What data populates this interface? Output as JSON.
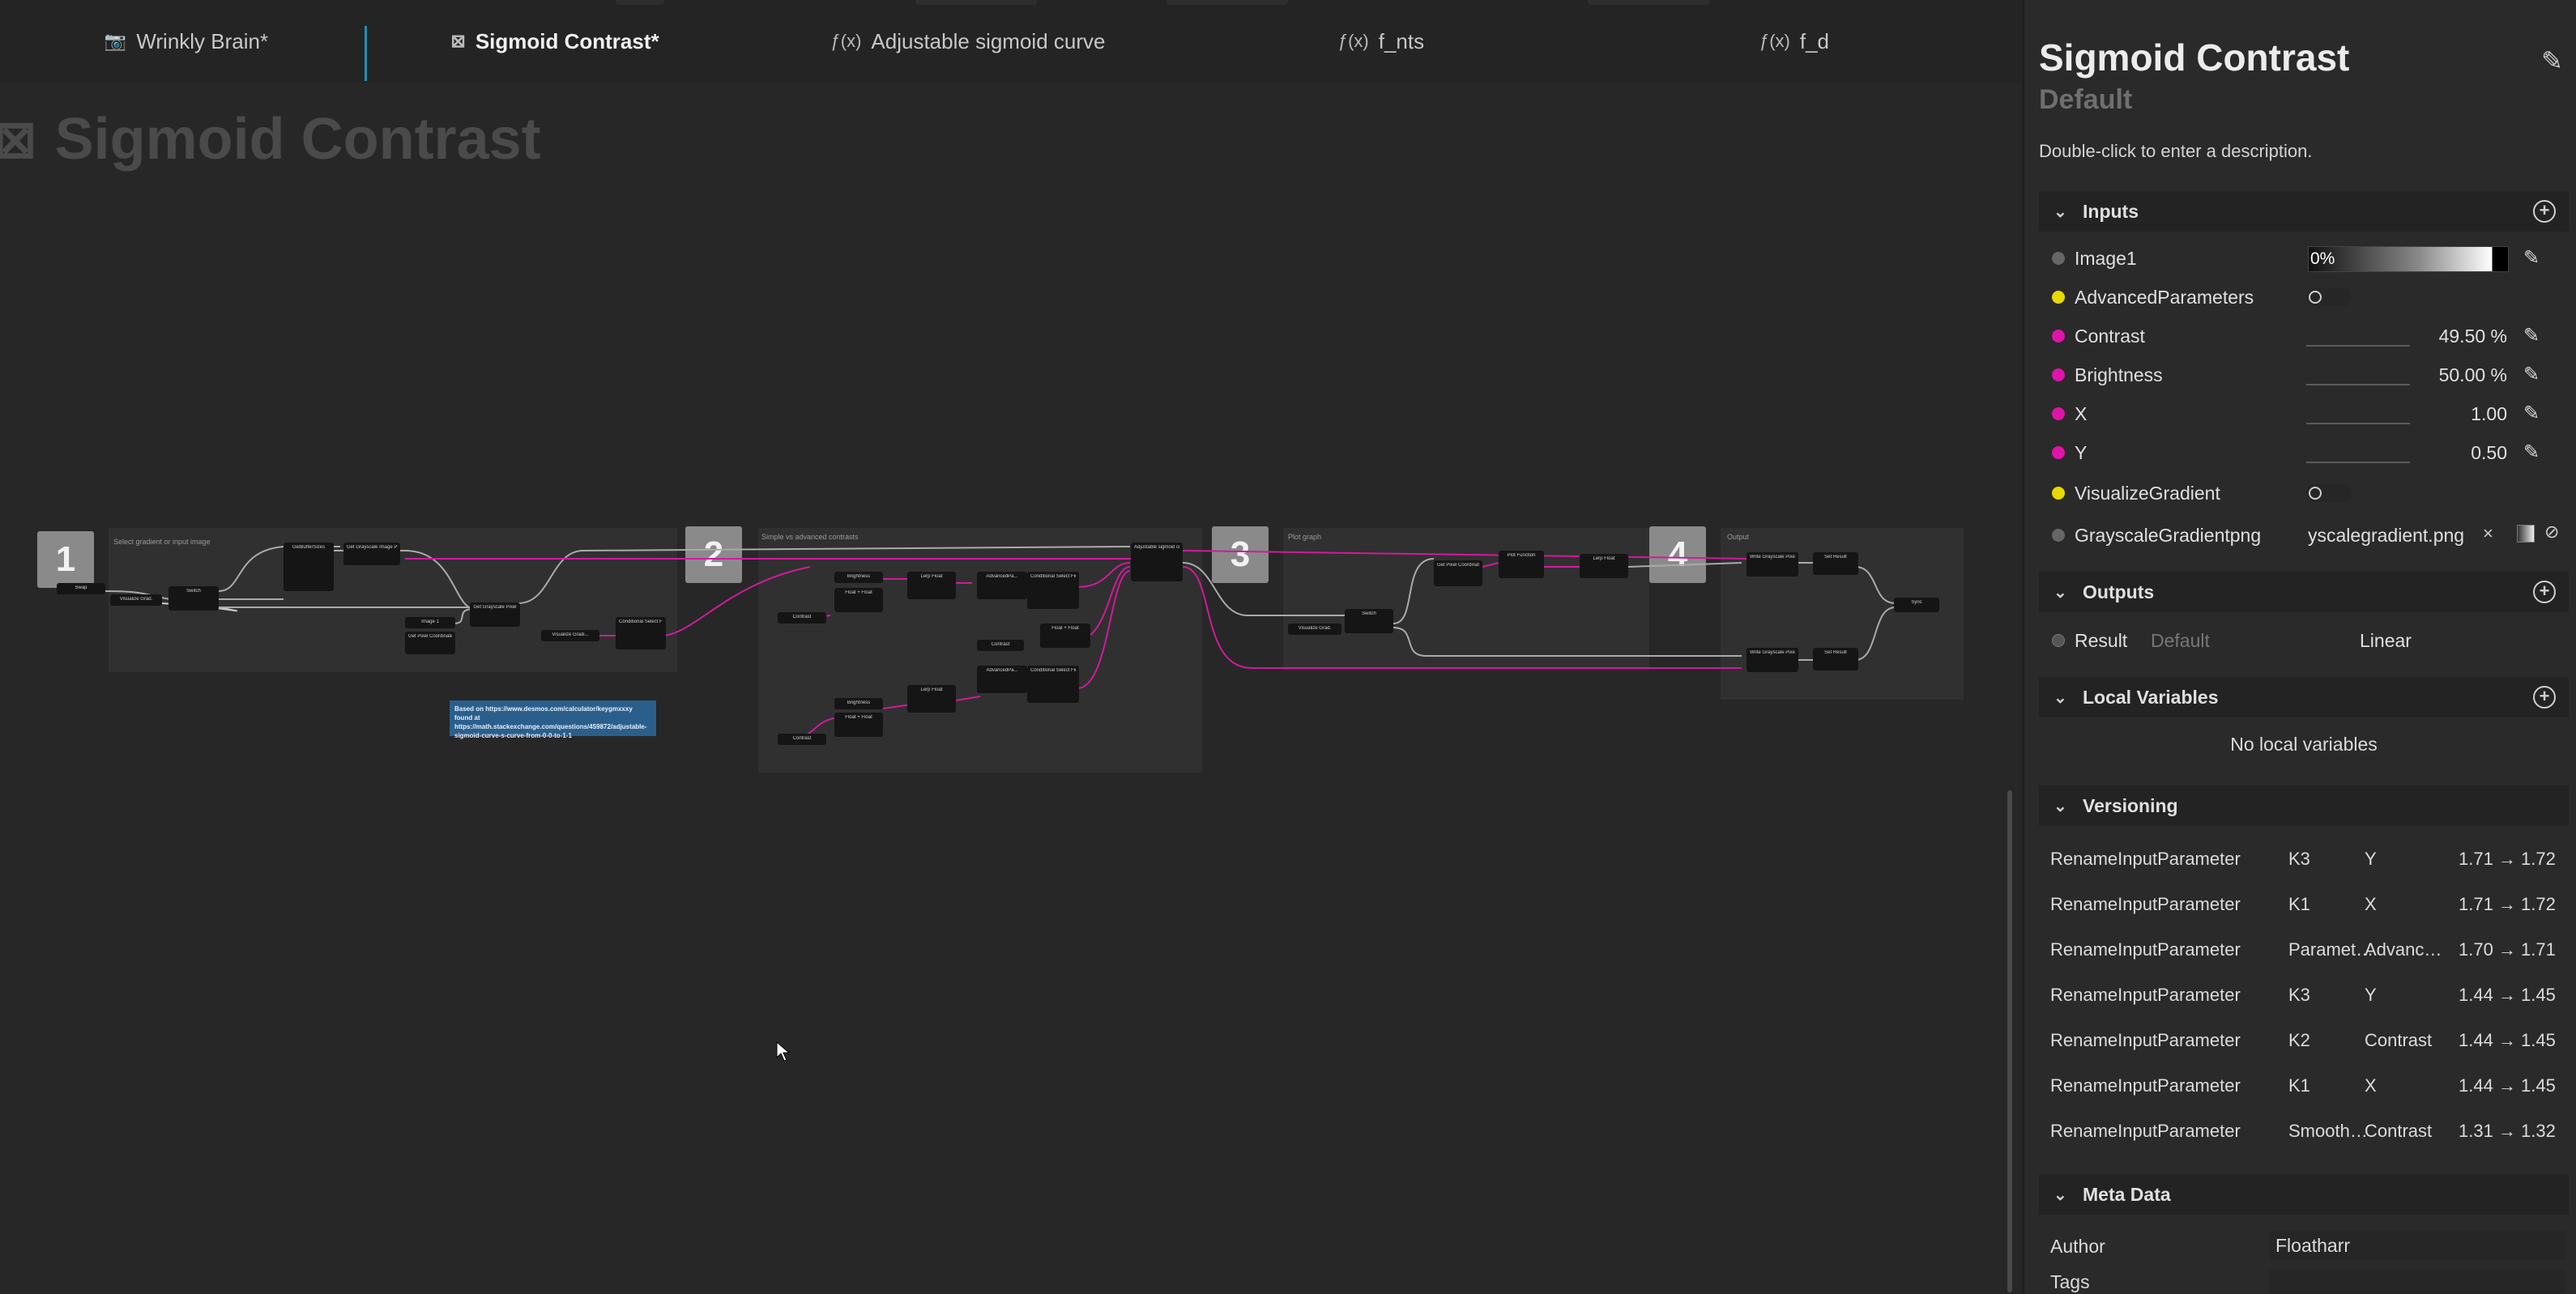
{
  "tabs": [
    {
      "icon": "📷",
      "label": "Wrinkly Brain*",
      "active": false
    },
    {
      "icon": "⊠",
      "label": "Sigmoid Contrast*",
      "active": true
    },
    {
      "icon": "ƒ(x)",
      "label": "Adjustable sigmoid curve",
      "active": false
    },
    {
      "icon": "ƒ(x)",
      "label": "f_nts",
      "active": false
    },
    {
      "icon": "ƒ(x)",
      "label": "f_d",
      "active": false
    }
  ],
  "graph": {
    "title": "Sigmoid Contrast",
    "frames": [
      {
        "number": "1",
        "label": "Select gradient or input image"
      },
      {
        "number": "2",
        "label": "Simple vs advanced contrasts"
      },
      {
        "number": "3",
        "label": "Plot graph"
      },
      {
        "number": "4",
        "label": "Output"
      }
    ],
    "comment": "Based on https://www.desmos.com/calculator/keygmxxxy found at https://math.stackexchange.com/questions/459872/adjustable-sigmoid-curve-s-curve-from-0-0-to-1-1"
  },
  "panel": {
    "title": "Sigmoid Contrast",
    "subtitle": "Default",
    "description": "Double-click to enter a description.",
    "sections": {
      "inputs": "Inputs",
      "outputs": "Outputs",
      "locals": "Local Variables",
      "versioning": "Versioning",
      "meta": "Meta Data"
    },
    "inputs": [
      {
        "name": "Image1",
        "dot": "#666666",
        "value": "0%",
        "kind": "gradient"
      },
      {
        "name": "AdvancedParameters",
        "dot": "#e8d800",
        "kind": "toggle"
      },
      {
        "name": "Contrast",
        "dot": "#e014a8",
        "value": "49.50 %",
        "kind": "number"
      },
      {
        "name": "Brightness",
        "dot": "#e014a8",
        "value": "50.00 %",
        "kind": "number"
      },
      {
        "name": "X",
        "dot": "#e014a8",
        "value": "1.00",
        "kind": "number"
      },
      {
        "name": "Y",
        "dot": "#e014a8",
        "value": "0.50",
        "kind": "number"
      },
      {
        "name": "VisualizeGradient",
        "dot": "#e8d800",
        "kind": "toggle"
      },
      {
        "name": "GrayscaleGradientpng",
        "dot": "#666666",
        "value": "yscalegradient.png",
        "kind": "file"
      }
    ],
    "outputs": [
      {
        "name": "Result",
        "default": "Default",
        "value": "Linear"
      }
    ],
    "locals_empty": "No local variables",
    "versioning": [
      {
        "action": "RenameInputParameter",
        "from": "K3",
        "to": "Y",
        "version": "1.71 → 1.72"
      },
      {
        "action": "RenameInputParameter",
        "from": "K1",
        "to": "X",
        "version": "1.71 → 1.72"
      },
      {
        "action": "RenameInputParameter",
        "from": "Paramet…",
        "to": "Advanc…",
        "version": "1.70 → 1.71"
      },
      {
        "action": "RenameInputParameter",
        "from": "K3",
        "to": "Y",
        "version": "1.44 → 1.45"
      },
      {
        "action": "RenameInputParameter",
        "from": "K2",
        "to": "Contrast",
        "version": "1.44 → 1.45"
      },
      {
        "action": "RenameInputParameter",
        "from": "K1",
        "to": "X",
        "version": "1.44 → 1.45"
      },
      {
        "action": "RenameInputParameter",
        "from": "Smooth…",
        "to": "Contrast",
        "version": "1.31 → 1.32"
      }
    ],
    "meta": [
      {
        "key": "Author",
        "value": "Floatharr"
      },
      {
        "key": "Tags",
        "value": ""
      }
    ]
  }
}
